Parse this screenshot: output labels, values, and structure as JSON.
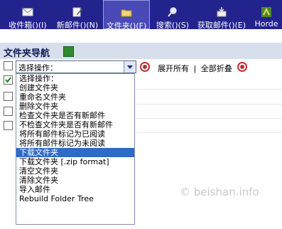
{
  "toolbar": {
    "buttons": [
      {
        "label": "收件箱()(I)",
        "icon": "envelope-icon"
      },
      {
        "label": "新邮件()(N)",
        "icon": "compose-icon"
      },
      {
        "label": "文件夹()(F)",
        "icon": "folder-icon",
        "active": true
      },
      {
        "label": "搜索()(S)",
        "icon": "magnifier-icon"
      },
      {
        "label": "获取邮件()(E)",
        "icon": "fetch-mail-icon"
      },
      {
        "label": "Horde",
        "icon": "horde-icon"
      }
    ]
  },
  "nav": {
    "title": "文件夹导航",
    "refresh_icon": "refresh-icon"
  },
  "controls": {
    "select_value": "选择操作：",
    "expand_all": "展开所有",
    "separator": "|",
    "collapse_all": "全部折叠"
  },
  "dropdown": {
    "options": [
      "选择操作：",
      "创建文件夹",
      "重命名文件夹",
      "删除文件夹",
      "检查文件夹是否有新邮件",
      "不检查文件夹是否有新邮件",
      "将所有邮件标记为已阅读",
      "将所有邮件标记为未阅读",
      "下载文件夹",
      "下载文件夹 [.zip format]",
      "清空文件夹",
      "清除文件夹",
      "导入邮件",
      "Rebuild Folder Tree"
    ],
    "selected_index": 8
  },
  "folder_checkboxes": [
    true,
    false,
    false,
    false
  ],
  "watermark": "© beishan.info",
  "colors": {
    "toolbar": "#23238e",
    "selected": "#3169c6",
    "nav_bg": "#d8dfec"
  }
}
